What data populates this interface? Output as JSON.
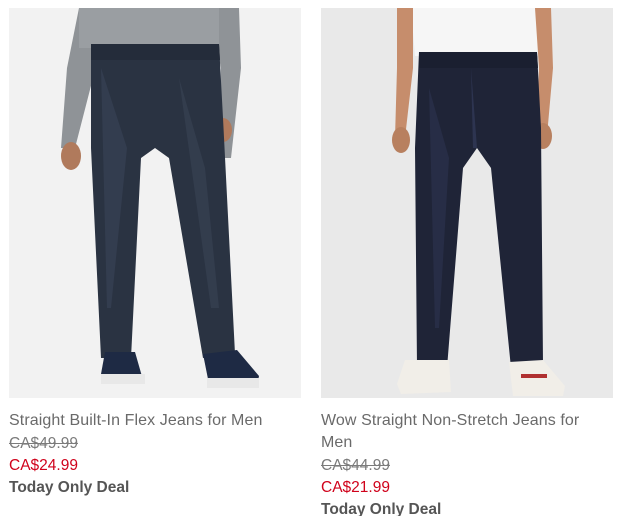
{
  "products": [
    {
      "name": "Straight Built-In Flex Jeans for Men",
      "original_price": "CA$49.99",
      "sale_price": "CA$24.99",
      "promo": "Today Only Deal",
      "image_icon": "product-photo-jeans-dark-wash",
      "colors": {
        "denim": "#2a3342",
        "shirt": "#8e9296",
        "shoes": "#1e2a44"
      }
    },
    {
      "name": "Wow Straight Non-Stretch Jeans for Men",
      "original_price": "CA$44.99",
      "sale_price": "CA$21.99",
      "promo": "Today Only Deal",
      "image_icon": "product-photo-jeans-rinse-wash",
      "colors": {
        "denim": "#1f2437",
        "shirt": "#f4f4f4",
        "shoes": "#f1eee8"
      }
    }
  ],
  "colors": {
    "sale": "#d0021b",
    "text": "#6a6a6a"
  }
}
